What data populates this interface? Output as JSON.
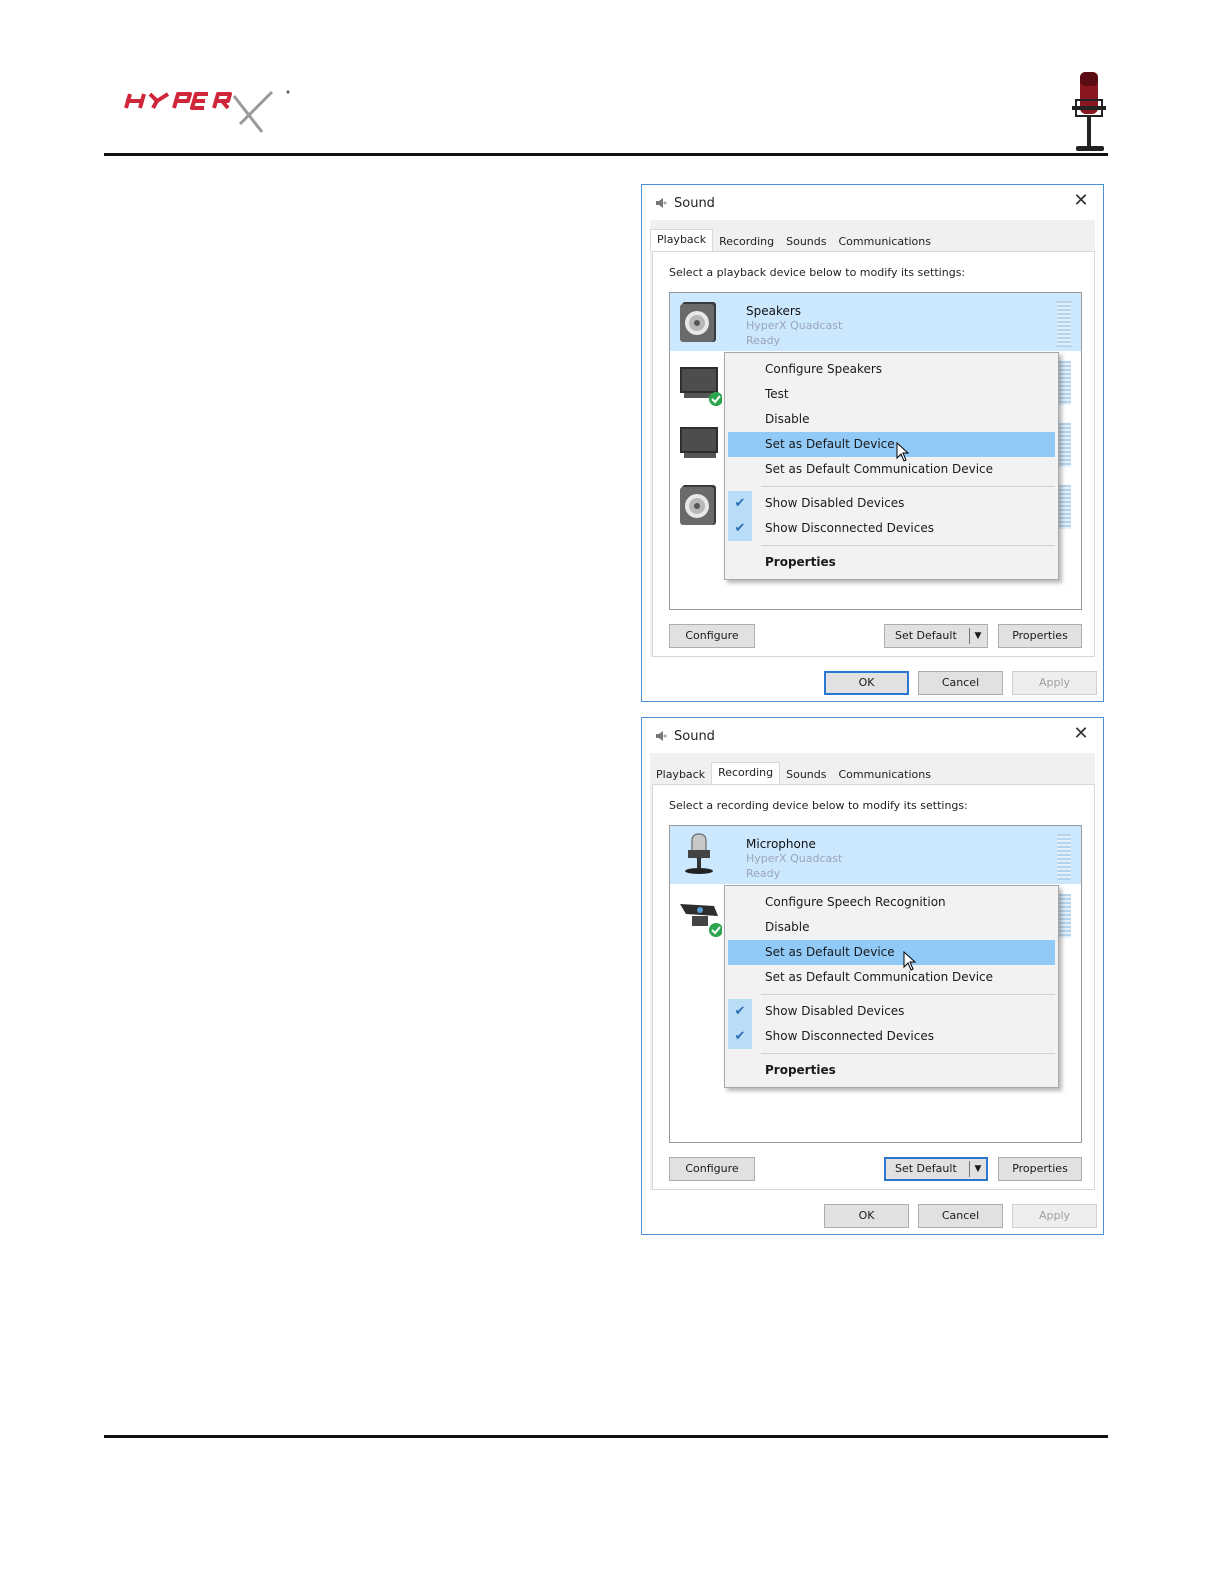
{
  "header": {
    "logo_text": "HYPERX"
  },
  "dialogs": [
    {
      "title": "Sound",
      "close_label": "✕",
      "tabs": [
        "Playback",
        "Recording",
        "Sounds",
        "Communications"
      ],
      "active_tab": "Playback",
      "instruction": "Select a playback device below to modify its settings:",
      "device": {
        "name": "Speakers",
        "sub": "HyperX Quadcast",
        "status": "Ready",
        "icon": "speaker-icon"
      },
      "menu": {
        "items": [
          "Configure Speakers",
          "Test",
          "Disable",
          "Set as Default Device",
          "Set as Default Communication Device"
        ],
        "checked": [
          "Show Disabled Devices",
          "Show Disconnected Devices"
        ],
        "properties": "Properties",
        "highlighted": "Set as Default Device"
      },
      "buttons": {
        "configure": "Configure",
        "set_default": "Set Default",
        "properties": "Properties",
        "ok": "OK",
        "cancel": "Cancel",
        "apply": "Apply"
      }
    },
    {
      "title": "Sound",
      "close_label": "✕",
      "tabs": [
        "Playback",
        "Recording",
        "Sounds",
        "Communications"
      ],
      "active_tab": "Recording",
      "instruction": "Select a recording device below to modify its settings:",
      "device": {
        "name": "Microphone",
        "sub": "HyperX Quadcast",
        "status": "Ready",
        "icon": "microphone-icon"
      },
      "menu": {
        "items": [
          "Configure Speech Recognition",
          "Disable",
          "Set as Default Device",
          "Set as Default Communication Device"
        ],
        "checked": [
          "Show Disabled Devices",
          "Show Disconnected Devices"
        ],
        "properties": "Properties",
        "highlighted": "Set as Default Device"
      },
      "buttons": {
        "configure": "Configure",
        "set_default": "Set Default",
        "properties": "Properties",
        "ok": "OK",
        "cancel": "Cancel",
        "apply": "Apply"
      }
    }
  ],
  "colors": {
    "brand_red": "#d0263a",
    "selection": "#cce8ff",
    "menu_highlight": "#91c9f7",
    "focus_blue": "#2b78d4"
  }
}
